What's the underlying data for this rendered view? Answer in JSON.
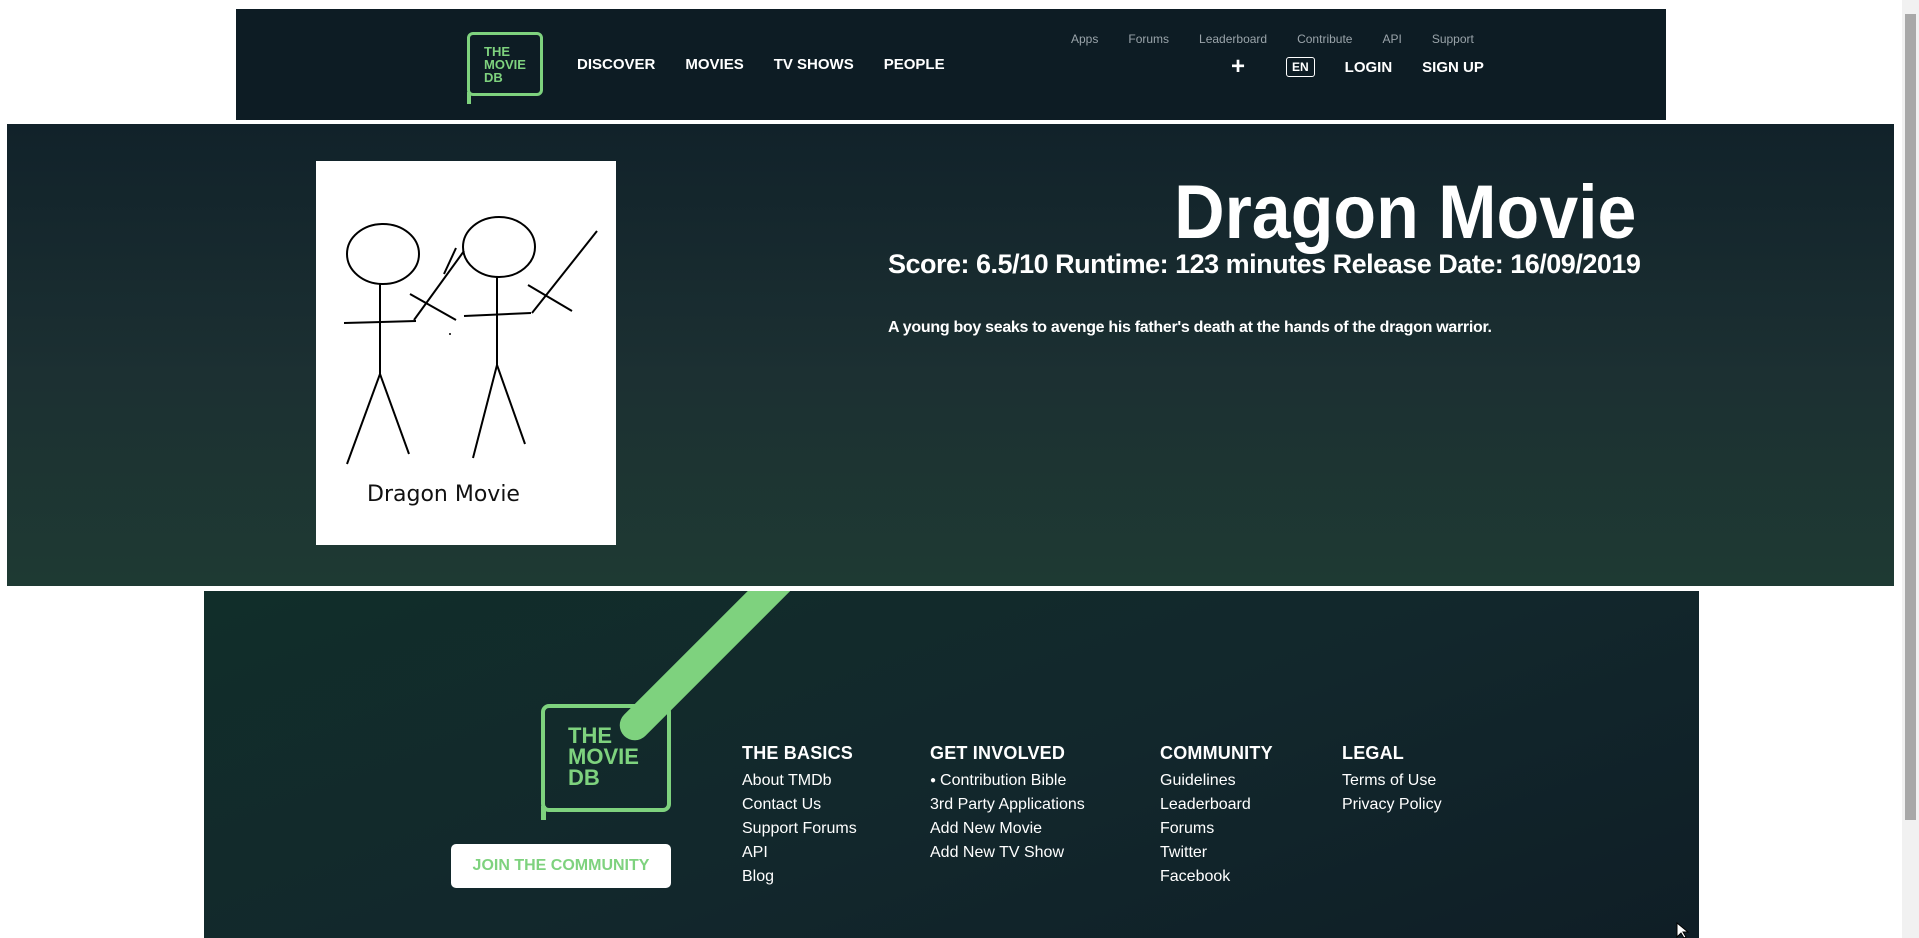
{
  "header": {
    "logo": [
      "THE",
      "MOVIE",
      "DB"
    ],
    "nav": [
      "DISCOVER",
      "MOVIES",
      "TV SHOWS",
      "PEOPLE"
    ],
    "top_links": [
      "Apps",
      "Forums",
      "Leaderboard",
      "Contribute",
      "API",
      "Support"
    ],
    "plus": "+",
    "language": "EN",
    "login": "LOGIN",
    "signup": "SIGN UP"
  },
  "movie": {
    "poster_caption": "Dragon Movie",
    "title": "Dragon Movie",
    "meta": "Score: 6.5/10 Runtime: 123 minutes Release Date: 16/09/2019",
    "overview": "A young boy seaks to avenge his father's death at the hands of the dragon warrior."
  },
  "footer": {
    "logo": [
      "THE",
      "MOVIE",
      "DB"
    ],
    "join_button": "JOIN THE COMMUNITY",
    "columns": [
      {
        "heading": "THE BASICS",
        "links": [
          "About TMDb",
          "Contact Us",
          "Support Forums",
          "API",
          "Blog"
        ]
      },
      {
        "heading": "GET INVOLVED",
        "links": [
          "Contribution Bible",
          "3rd Party Applications",
          "Add New Movie",
          "Add New TV Show"
        ]
      },
      {
        "heading": "COMMUNITY",
        "links": [
          "Guidelines",
          "Leaderboard",
          "Forums",
          "Twitter",
          "Facebook"
        ]
      },
      {
        "heading": "LEGAL",
        "links": [
          "Terms of Use",
          "Privacy Policy"
        ]
      }
    ]
  },
  "colors": {
    "brand_green": "#7ed27e",
    "header_bg": "#0d1c24"
  }
}
